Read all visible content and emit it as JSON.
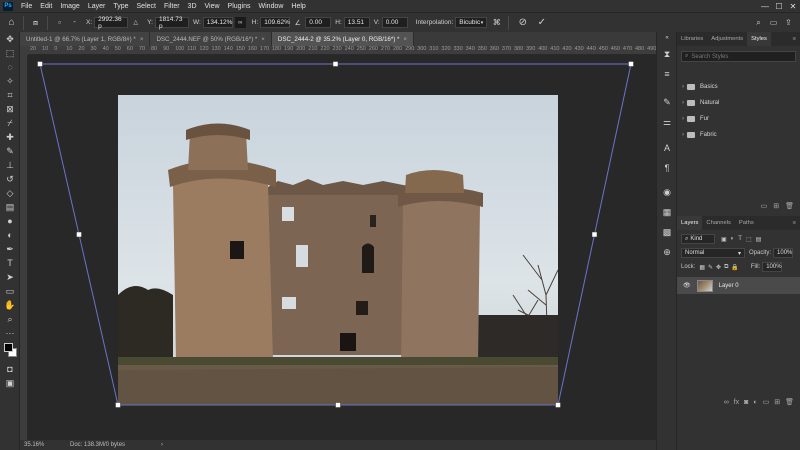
{
  "app": {
    "logo": "Ps"
  },
  "menu": [
    "File",
    "Edit",
    "Image",
    "Layer",
    "Type",
    "Select",
    "Filter",
    "3D",
    "View",
    "Plugins",
    "Window",
    "Help"
  ],
  "window_controls": {
    "minimize": "—",
    "maximize": "☐",
    "close": "✕"
  },
  "options": {
    "x_label": "X:",
    "x_value": "2992.36 p",
    "y_label": "Y:",
    "y_value": "1814.73 p",
    "w_label": "W:",
    "w_value": "134.12%",
    "h_label": "H:",
    "h_value": "109.62%",
    "angle_value": "0.00",
    "h_skew_label": "H:",
    "h_skew_value": "13.51",
    "v_skew_label": "V:",
    "v_skew_value": "0.00",
    "interp_label": "Interpolation:",
    "interp_value": "Bicubic",
    "cancel_icon": "cancel-icon",
    "commit_icon": "checkmark-icon"
  },
  "tabs": [
    {
      "label": "Untitled-1 @ 66.7% (Layer 1, RGB/8#) *",
      "active": false
    },
    {
      "label": "DSC_2444.NEF @ 50% (RGB/16*) *",
      "active": false
    },
    {
      "label": "DSC_2444-2 @ 35.2% (Layer 0, RGB/16*) *",
      "active": true
    }
  ],
  "ruler": [
    "20",
    "10",
    "0",
    "10",
    "20",
    "30",
    "40",
    "50",
    "60",
    "70",
    "80",
    "90",
    "100",
    "110",
    "120",
    "130",
    "140",
    "150",
    "160",
    "170",
    "180",
    "190",
    "200",
    "210",
    "220",
    "230",
    "240",
    "250",
    "260",
    "270",
    "280",
    "290",
    "300",
    "310",
    "320",
    "330",
    "340",
    "350",
    "360",
    "370",
    "380",
    "390",
    "400",
    "410",
    "420",
    "430",
    "440",
    "450",
    "460",
    "470",
    "480",
    "490"
  ],
  "status": {
    "zoom": "35.16%",
    "doc": "Doc: 138.3M/0 bytes",
    "arrow": "›"
  },
  "panel_top": {
    "tabs": [
      "Libraries",
      "Adjustments",
      "Styles"
    ],
    "search_placeholder": "Search Styles",
    "folders": [
      "Basics",
      "Natural",
      "Fur",
      "Fabric"
    ]
  },
  "layers_panel": {
    "tabs": [
      "Layers",
      "Channels",
      "Paths"
    ],
    "kind_label": "Kind",
    "blend_mode": "Normal",
    "opacity_label": "Opacity:",
    "opacity_value": "100%",
    "lock_label": "Lock:",
    "fill_label": "Fill:",
    "fill_value": "100%",
    "layer_name": "Layer 0"
  }
}
